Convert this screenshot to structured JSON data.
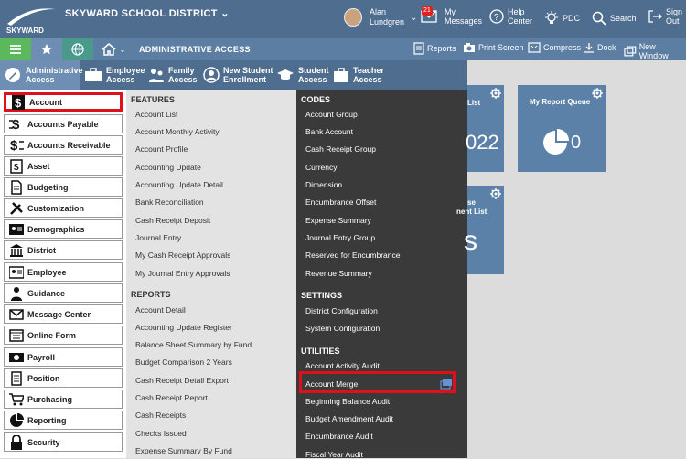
{
  "header": {
    "logo_text": "SKYWARD",
    "district": "SKYWARD SCHOOL DISTRICT",
    "user_first": "Alan",
    "user_last": "Lundgren",
    "messages_label": "My Messages",
    "messages_count": "21",
    "help_label": "Help Center",
    "pdc_label": "PDC",
    "search_label": "Search",
    "signout_label": "Sign Out"
  },
  "navbar": {
    "section": "ADMINISTRATIVE ACCESS",
    "reports": "Reports",
    "print_screen": "Print Screen",
    "compress": "Compress",
    "dock": "Dock",
    "new_window": "New Window"
  },
  "modules": [
    {
      "l1": "Administrative",
      "l2": "Access"
    },
    {
      "l1": "Employee",
      "l2": "Access"
    },
    {
      "l1": "Family",
      "l2": "Access"
    },
    {
      "l1": "New Student",
      "l2": "Enrollment"
    },
    {
      "l1": "Student",
      "l2": "Access"
    },
    {
      "l1": "Teacher",
      "l2": "Access"
    }
  ],
  "sidebar": [
    "Account",
    "Accounts Payable",
    "Accounts Receivable",
    "Asset",
    "Budgeting",
    "Customization",
    "Demographics",
    "District",
    "Employee",
    "Guidance",
    "Message Center",
    "Online Form",
    "Payroll",
    "Position",
    "Purchasing",
    "Reporting",
    "Security"
  ],
  "features": {
    "title": "FEATURES",
    "items": [
      "Account List",
      "Account Monthly Activity",
      "Account Profile",
      "Accounting Update",
      "Accounting Update Detail",
      "Bank Reconciliation",
      "Cash Receipt Deposit",
      "Journal Entry",
      "My Cash Receipt Approvals",
      "My Journal Entry Approvals"
    ]
  },
  "reports": {
    "title": "REPORTS",
    "items": [
      "Account Detail",
      "Accounting Update Register",
      "Balance Sheet Summary by Fund",
      "Budget Comparison 2 Years",
      "Cash Receipt Detail Export",
      "Cash Receipt Report",
      "Cash Receipts",
      "Checks Issued",
      "Expense Summary By Fund"
    ]
  },
  "codes": {
    "title": "CODES",
    "items": [
      "Account Group",
      "Bank Account",
      "Cash Receipt Group",
      "Currency",
      "Dimension",
      "Encumbrance Offset",
      "Expense Summary",
      "Journal Entry Group",
      "Reserved for Encumbrance",
      "Revenue Summary"
    ]
  },
  "settings": {
    "title": "SETTINGS",
    "items": [
      "District Configuration",
      "System Configuration"
    ]
  },
  "utilities": {
    "title": "UTILITIES",
    "items": [
      "Account Activity Audit",
      "Account Merge",
      "Beginning Balance Audit",
      "Budget Amendment Audit",
      "Encumbrance Audit",
      "Fiscal Year Audit"
    ]
  },
  "tiles": {
    "tile1_title": "List",
    "tile1_value": "022",
    "tile2_title": "My Report Queue",
    "tile2_value": "0",
    "tile3_title1": "se",
    "tile3_title2": "nent List",
    "tile3_value": "s"
  }
}
